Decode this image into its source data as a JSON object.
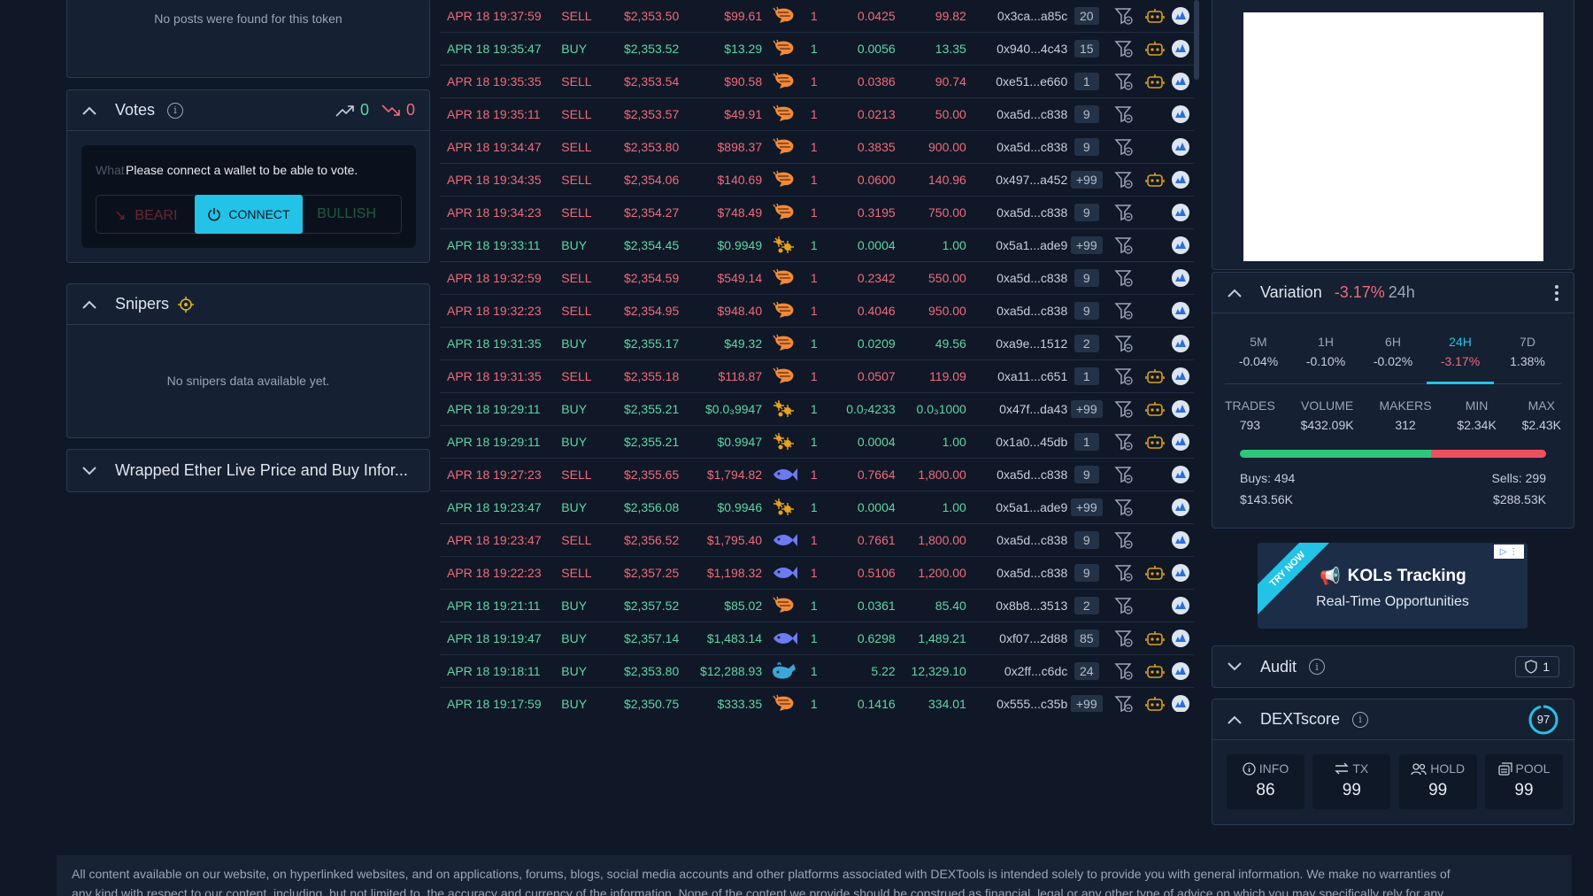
{
  "posts": {
    "empty_text": "No posts were found for this token"
  },
  "votes": {
    "title": "Votes",
    "up_count": "0",
    "down_count": "0",
    "question_partial": "What",
    "connect_prompt": "Please connect a wallet to be able to vote.",
    "bearish_label": "BEARI",
    "connect_label": "CONNECT",
    "bullish_label": "BULLISH"
  },
  "snipers": {
    "title": "Snipers",
    "empty_text": "No snipers data available yet."
  },
  "wrapped": {
    "title": "Wrapped Ether Live Price and Buy Infor..."
  },
  "trades": [
    {
      "date": "APR 18 19:37:59",
      "type": "SELL",
      "price": "$2,353.50",
      "total": "$99.61",
      "icon": "shrimp",
      "qty": "1",
      "amount": "0.0425",
      "usd": "99.82",
      "maker": "0x3ca...a85c",
      "count": "20",
      "bot": true
    },
    {
      "date": "APR 18 19:35:47",
      "type": "BUY",
      "price": "$2,353.52",
      "total": "$13.29",
      "icon": "shrimp",
      "qty": "1",
      "amount": "0.0056",
      "usd": "13.35",
      "maker": "0x940...4c43",
      "count": "15",
      "bot": true
    },
    {
      "date": "APR 18 19:35:35",
      "type": "SELL",
      "price": "$2,353.54",
      "total": "$90.58",
      "icon": "shrimp",
      "qty": "1",
      "amount": "0.0386",
      "usd": "90.74",
      "maker": "0xe51...e660",
      "count": "1",
      "bot": true
    },
    {
      "date": "APR 18 19:35:11",
      "type": "SELL",
      "price": "$2,353.57",
      "total": "$49.91",
      "icon": "shrimp",
      "qty": "1",
      "amount": "0.0213",
      "usd": "50.00",
      "maker": "0xa5d...c838",
      "count": "9",
      "bot": false
    },
    {
      "date": "APR 18 19:34:47",
      "type": "SELL",
      "price": "$2,353.80",
      "total": "$898.37",
      "icon": "shrimp",
      "qty": "1",
      "amount": "0.3835",
      "usd": "900.00",
      "maker": "0xa5d...c838",
      "count": "9",
      "bot": false
    },
    {
      "date": "APR 18 19:34:35",
      "type": "SELL",
      "price": "$2,354.06",
      "total": "$140.69",
      "icon": "shrimp",
      "qty": "1",
      "amount": "0.0600",
      "usd": "140.96",
      "maker": "0x497...a452",
      "count": "+99",
      "bot": true
    },
    {
      "date": "APR 18 19:34:23",
      "type": "SELL",
      "price": "$2,354.27",
      "total": "$748.49",
      "icon": "shrimp",
      "qty": "1",
      "amount": "0.3195",
      "usd": "750.00",
      "maker": "0xa5d...c838",
      "count": "9",
      "bot": false
    },
    {
      "date": "APR 18 19:33:11",
      "type": "BUY",
      "price": "$2,354.45",
      "total": "$0.9949",
      "icon": "plankton",
      "qty": "1",
      "amount": "0.0004",
      "usd": "1.00",
      "maker": "0x5a1...ade9",
      "count": "+99",
      "bot": false
    },
    {
      "date": "APR 18 19:32:59",
      "type": "SELL",
      "price": "$2,354.59",
      "total": "$549.14",
      "icon": "shrimp",
      "qty": "1",
      "amount": "0.2342",
      "usd": "550.00",
      "maker": "0xa5d...c838",
      "count": "9",
      "bot": false
    },
    {
      "date": "APR 18 19:32:23",
      "type": "SELL",
      "price": "$2,354.95",
      "total": "$948.40",
      "icon": "shrimp",
      "qty": "1",
      "amount": "0.4046",
      "usd": "950.00",
      "maker": "0xa5d...c838",
      "count": "9",
      "bot": false
    },
    {
      "date": "APR 18 19:31:35",
      "type": "BUY",
      "price": "$2,355.17",
      "total": "$49.32",
      "icon": "shrimp",
      "qty": "1",
      "amount": "0.0209",
      "usd": "49.56",
      "maker": "0xa9e...1512",
      "count": "2",
      "bot": false
    },
    {
      "date": "APR 18 19:31:35",
      "type": "SELL",
      "price": "$2,355.18",
      "total": "$118.87",
      "icon": "shrimp",
      "qty": "1",
      "amount": "0.0507",
      "usd": "119.09",
      "maker": "0xa11...c651",
      "count": "1",
      "bot": true
    },
    {
      "date": "APR 18 19:29:11",
      "type": "BUY",
      "price": "$2,355.21",
      "total": "$0.0₃9947",
      "icon": "plankton",
      "qty": "1",
      "amount": "0.0₇4233",
      "usd": "0.0₃1000",
      "maker": "0x47f...da43",
      "count": "+99",
      "bot": true
    },
    {
      "date": "APR 18 19:29:11",
      "type": "BUY",
      "price": "$2,355.21",
      "total": "$0.9947",
      "icon": "plankton",
      "qty": "1",
      "amount": "0.0004",
      "usd": "1.00",
      "maker": "0x1a0...45db",
      "count": "1",
      "bot": true
    },
    {
      "date": "APR 18 19:27:23",
      "type": "SELL",
      "price": "$2,355.65",
      "total": "$1,794.82",
      "icon": "fish",
      "qty": "1",
      "amount": "0.7664",
      "usd": "1,800.00",
      "maker": "0xa5d...c838",
      "count": "9",
      "bot": false
    },
    {
      "date": "APR 18 19:23:47",
      "type": "BUY",
      "price": "$2,356.08",
      "total": "$0.9946",
      "icon": "plankton",
      "qty": "1",
      "amount": "0.0004",
      "usd": "1.00",
      "maker": "0x5a1...ade9",
      "count": "+99",
      "bot": false
    },
    {
      "date": "APR 18 19:23:47",
      "type": "SELL",
      "price": "$2,356.52",
      "total": "$1,795.40",
      "icon": "fish",
      "qty": "1",
      "amount": "0.7661",
      "usd": "1,800.00",
      "maker": "0xa5d...c838",
      "count": "9",
      "bot": false
    },
    {
      "date": "APR 18 19:22:23",
      "type": "SELL",
      "price": "$2,357.25",
      "total": "$1,198.32",
      "icon": "fish",
      "qty": "1",
      "amount": "0.5106",
      "usd": "1,200.00",
      "maker": "0xa5d...c838",
      "count": "9",
      "bot": true
    },
    {
      "date": "APR 18 19:21:11",
      "type": "BUY",
      "price": "$2,357.52",
      "total": "$85.02",
      "icon": "shrimp",
      "qty": "1",
      "amount": "0.0361",
      "usd": "85.40",
      "maker": "0x8b8...3513",
      "count": "2",
      "bot": false
    },
    {
      "date": "APR 18 19:19:47",
      "type": "BUY",
      "price": "$2,357.14",
      "total": "$1,483.14",
      "icon": "fish",
      "qty": "1",
      "amount": "0.6298",
      "usd": "1,489.21",
      "maker": "0xf07...2d88",
      "count": "85",
      "bot": true
    },
    {
      "date": "APR 18 19:18:11",
      "type": "BUY",
      "price": "$2,353.80",
      "total": "$12,288.93",
      "icon": "whale",
      "qty": "1",
      "amount": "5.22",
      "usd": "12,329.10",
      "maker": "0x2ff...c6dc",
      "count": "24",
      "bot": true
    },
    {
      "date": "APR 18 19:17:59",
      "type": "BUY",
      "price": "$2,350.75",
      "total": "$333.35",
      "icon": "shrimp",
      "qty": "1",
      "amount": "0.1416",
      "usd": "334.01",
      "maker": "0x555...c35b",
      "count": "+99",
      "bot": true
    }
  ],
  "variation": {
    "title": "Variation",
    "change": "-3.17%",
    "period": "24h",
    "tabs": [
      {
        "label": "5M",
        "value": "-0.04%"
      },
      {
        "label": "1H",
        "value": "-0.10%"
      },
      {
        "label": "6H",
        "value": "-0.02%"
      },
      {
        "label": "24H",
        "value": "-3.17%"
      },
      {
        "label": "7D",
        "value": "1.38%"
      }
    ],
    "active_tab": 3,
    "stats": [
      {
        "label": "TRADES",
        "value": "793"
      },
      {
        "label": "VOLUME",
        "value": "$432.09K"
      },
      {
        "label": "MAKERS",
        "value": "312"
      },
      {
        "label": "MIN",
        "value": "$2.34K"
      },
      {
        "label": "MAX",
        "value": "$2.43K"
      }
    ],
    "buy_fraction": 0.623,
    "buys_label": "Buys: 494",
    "buys_value": "$143.56K",
    "sells_label": "Sells: 299",
    "sells_value": "$288.53K",
    "colors": {
      "buy": "#2ec77b",
      "sell": "#f0505e",
      "accent": "#22c3e6"
    }
  },
  "ad": {
    "badge": "TRY NOW",
    "title": "KOLs Tracking",
    "subtitle": "Real-Time Opportunities"
  },
  "audit": {
    "title": "Audit",
    "badge_count": "1"
  },
  "dextscore": {
    "title": "DEXTscore",
    "score": "97",
    "items": [
      {
        "label": "INFO",
        "value": "86",
        "icon": "info-icon"
      },
      {
        "label": "TX",
        "value": "99",
        "icon": "swap-icon"
      },
      {
        "label": "HOLD",
        "value": "99",
        "icon": "users-icon"
      },
      {
        "label": "POOL",
        "value": "99",
        "icon": "pool-icon"
      }
    ]
  },
  "footer": {
    "line1": "All content available on our website, on hyperlinked websites, and on applications, forums, blogs, social media accounts and other platforms associated with DEXTools is intended solely to provide you with general information. We make no warranties of",
    "line2": "any kind with respect to our content, including, but not limited to, the accuracy and currency of the information. None of the content we provide should be construed as financial, legal or any other type of advice on which you may specifically rely for any"
  }
}
